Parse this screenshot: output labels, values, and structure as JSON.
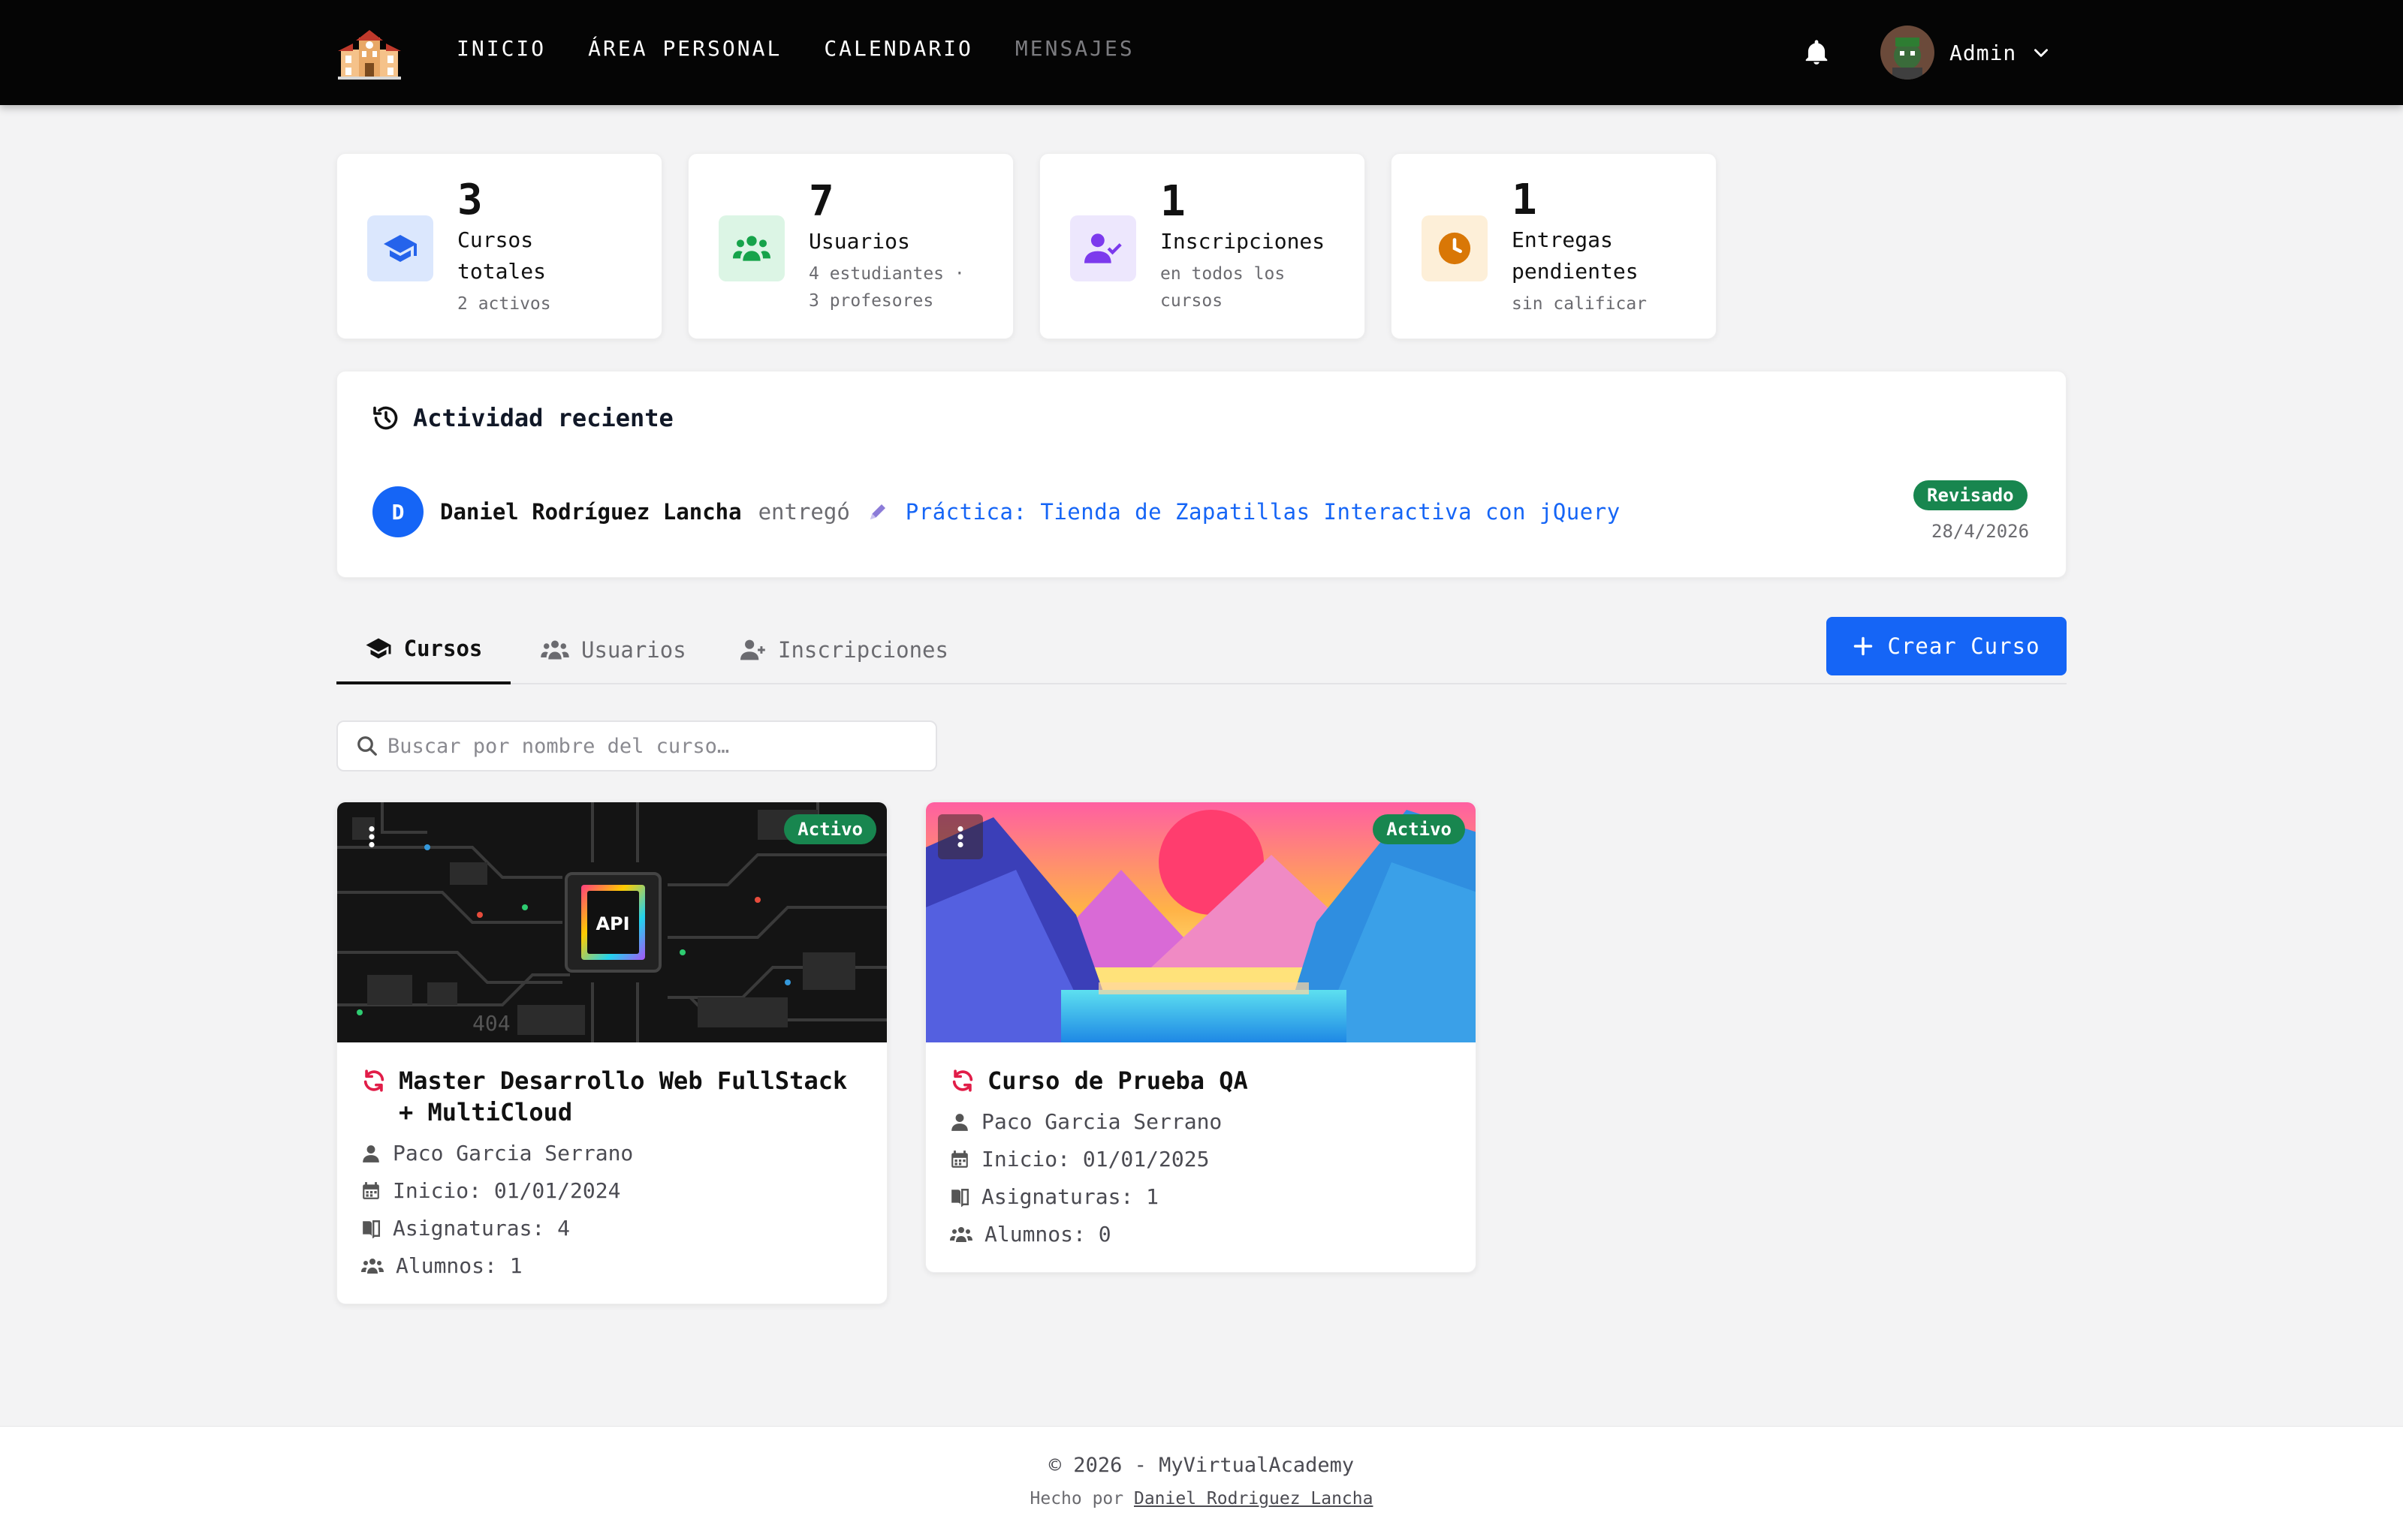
{
  "nav": {
    "links": [
      "INICIO",
      "ÁREA PERSONAL",
      "CALENDARIO",
      "MENSAJES"
    ],
    "user_name": "Admin"
  },
  "stats": [
    {
      "value": "3",
      "label_1": "Cursos",
      "label_2": "totales",
      "sub_1": "2 activos",
      "sub_2": "",
      "icon": "graduation-cap-icon",
      "color": "#2563eb",
      "bg": "#dbeafe"
    },
    {
      "value": "7",
      "label_1": "Usuarios",
      "label_2": "",
      "sub_1": "4 estudiantes ·",
      "sub_2": "3 profesores",
      "icon": "users-icon",
      "color": "#16a34a",
      "bg": "#dcfce7"
    },
    {
      "value": "1",
      "label_1": "Inscripciones",
      "label_2": "",
      "sub_1": "en todos los",
      "sub_2": "cursos",
      "icon": "user-check-icon",
      "color": "#7c3aed",
      "bg": "#ede9fe"
    },
    {
      "value": "1",
      "label_1": "Entregas",
      "label_2": "pendientes",
      "sub_1": "sin calificar",
      "sub_2": "",
      "icon": "clock-icon",
      "color": "#d97706",
      "bg": "#fef3c7"
    }
  ],
  "activity": {
    "title": "Actividad reciente",
    "items": [
      {
        "initial": "D",
        "user": "Daniel Rodríguez Lancha",
        "verb": "entregó",
        "link": "Práctica: Tienda de Zapatillas Interactiva con jQuery",
        "status": "Revisado",
        "date": "28/4/2026"
      }
    ]
  },
  "tabs": [
    "Cursos",
    "Usuarios",
    "Inscripciones"
  ],
  "create_button": "Crear Curso",
  "search": {
    "placeholder": "Buscar por nombre del curso…"
  },
  "courses": [
    {
      "title_1": "Master Desarrollo Web FullStack",
      "title_2": "+ MultiCloud",
      "status": "Activo",
      "teacher": "Paco Garcia Serrano",
      "start": "Inicio: 01/01/2024",
      "subjects": "Asignaturas: 4",
      "students": "Alumnos: 1",
      "image_label": "API",
      "image_label_2": "404"
    },
    {
      "title_1": "Curso de Prueba QA",
      "title_2": "",
      "status": "Activo",
      "teacher": "Paco Garcia Serrano",
      "start": "Inicio: 01/01/2025",
      "subjects": "Asignaturas: 1",
      "students": "Alumnos: 0"
    }
  ],
  "footer": {
    "line1": "© 2026 - MyVirtualAcademy",
    "prefix": "Hecho por",
    "author": "Daniel Rodriguez Lancha"
  }
}
